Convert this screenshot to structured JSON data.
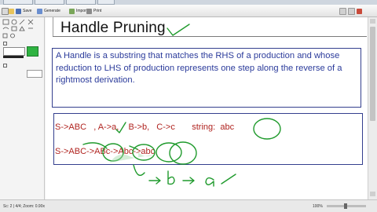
{
  "toolbar": {
    "save_label": "Save",
    "generate_label": "Generate",
    "import_label": "Import",
    "print_label": "Print"
  },
  "slide": {
    "title": "Handle Pruning",
    "definition": "A Handle is a substring that matches the RHS of a production and whose reduction to LHS of production represents one step along the reverse of a rightmost derivation.",
    "productions": "S->ABC   , A->a,    B->b,   C->c",
    "string_label": "string:",
    "string_value": "abc",
    "derivation": "S->ABC->ABc->Abc->abc"
  },
  "status": {
    "left": "Sc: 2 | 4/4; Zoom: 0.90x",
    "zoom": "100%"
  },
  "colors": {
    "title": "#111111",
    "definition_text": "#2b3b9b",
    "box_border": "#343f8e",
    "example_text": "#b0231f",
    "ink": "#1f9a2c"
  }
}
